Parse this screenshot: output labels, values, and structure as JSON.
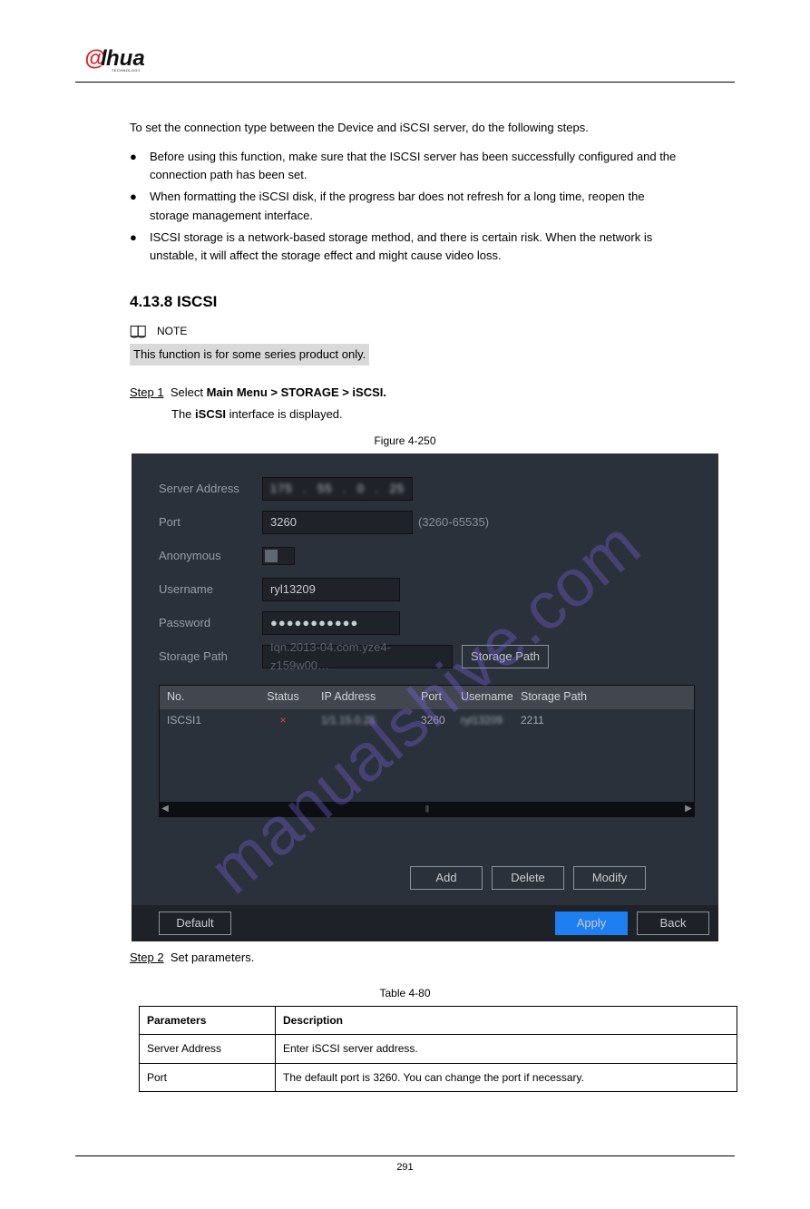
{
  "logo": {
    "brand": "alhua",
    "sub": "TECHNOLOGY"
  },
  "intro_heading": "To set the connection type between the Device and iSCSI server, do the following steps.",
  "bullets": [
    "Before using this function, make sure that the ISCSI server has been successfully configured and the connection path has been set.",
    "When formatting the iSCSI disk, if the progress bar does not refresh for a long time, reopen the storage management interface.",
    "ISCSI storage is a network-based storage method, and there is certain risk. When the network is unstable, it will affect the storage effect and might cause video loss."
  ],
  "note_label": "NOTE",
  "note_text": "This function is for some series product only.",
  "step1": {
    "head": "Step 1",
    "body_a": "Select",
    "body_b": "Main Menu > STORAGE > iSCSI.",
    "body_c": "The",
    "body_d": "iSCSI",
    "body_e": "interface is displayed."
  },
  "fig_caption": "Figure 4-250",
  "ui": {
    "labels": {
      "server": "Server Address",
      "port": "Port",
      "anon": "Anonymous",
      "user": "Username",
      "pass": "Password",
      "spath": "Storage Path"
    },
    "values": {
      "ip": [
        "175",
        "55",
        "0",
        "25"
      ],
      "port": "3260",
      "port_hint": "(3260-65535)",
      "user": "ryl13209",
      "pass": "●●●●●●●●●●●",
      "path": "Iqn.2013-04.com.yze4-z159w00…"
    },
    "btn_spath": "Storage Path",
    "thead": {
      "no": "No.",
      "status": "Status",
      "ip": "IP Address",
      "port": "Port",
      "user": "Username",
      "spath": "Storage Path"
    },
    "row": {
      "no": "ISCSI1",
      "status": "×",
      "ip": "1/1.15.0.25",
      "port": "3260",
      "user": "ryl13209",
      "spath": "2211"
    },
    "buttons": {
      "add": "Add",
      "delete": "Delete",
      "modify": "Modify",
      "default": "Default",
      "apply": "Apply",
      "back": "Back"
    }
  },
  "step2": {
    "head": "Step 2",
    "body": "Set parameters."
  },
  "table_caption": "Table 4-80",
  "ptable": {
    "h1": "Parameters",
    "h2": "Description",
    "r1p": "Server Address",
    "r1d": "Enter iSCSI server address.",
    "r2p": "Port",
    "r2d": "The default port is 3260. You can change the port if necessary."
  },
  "watermark": "manualshive.com",
  "pagefoot": "291"
}
